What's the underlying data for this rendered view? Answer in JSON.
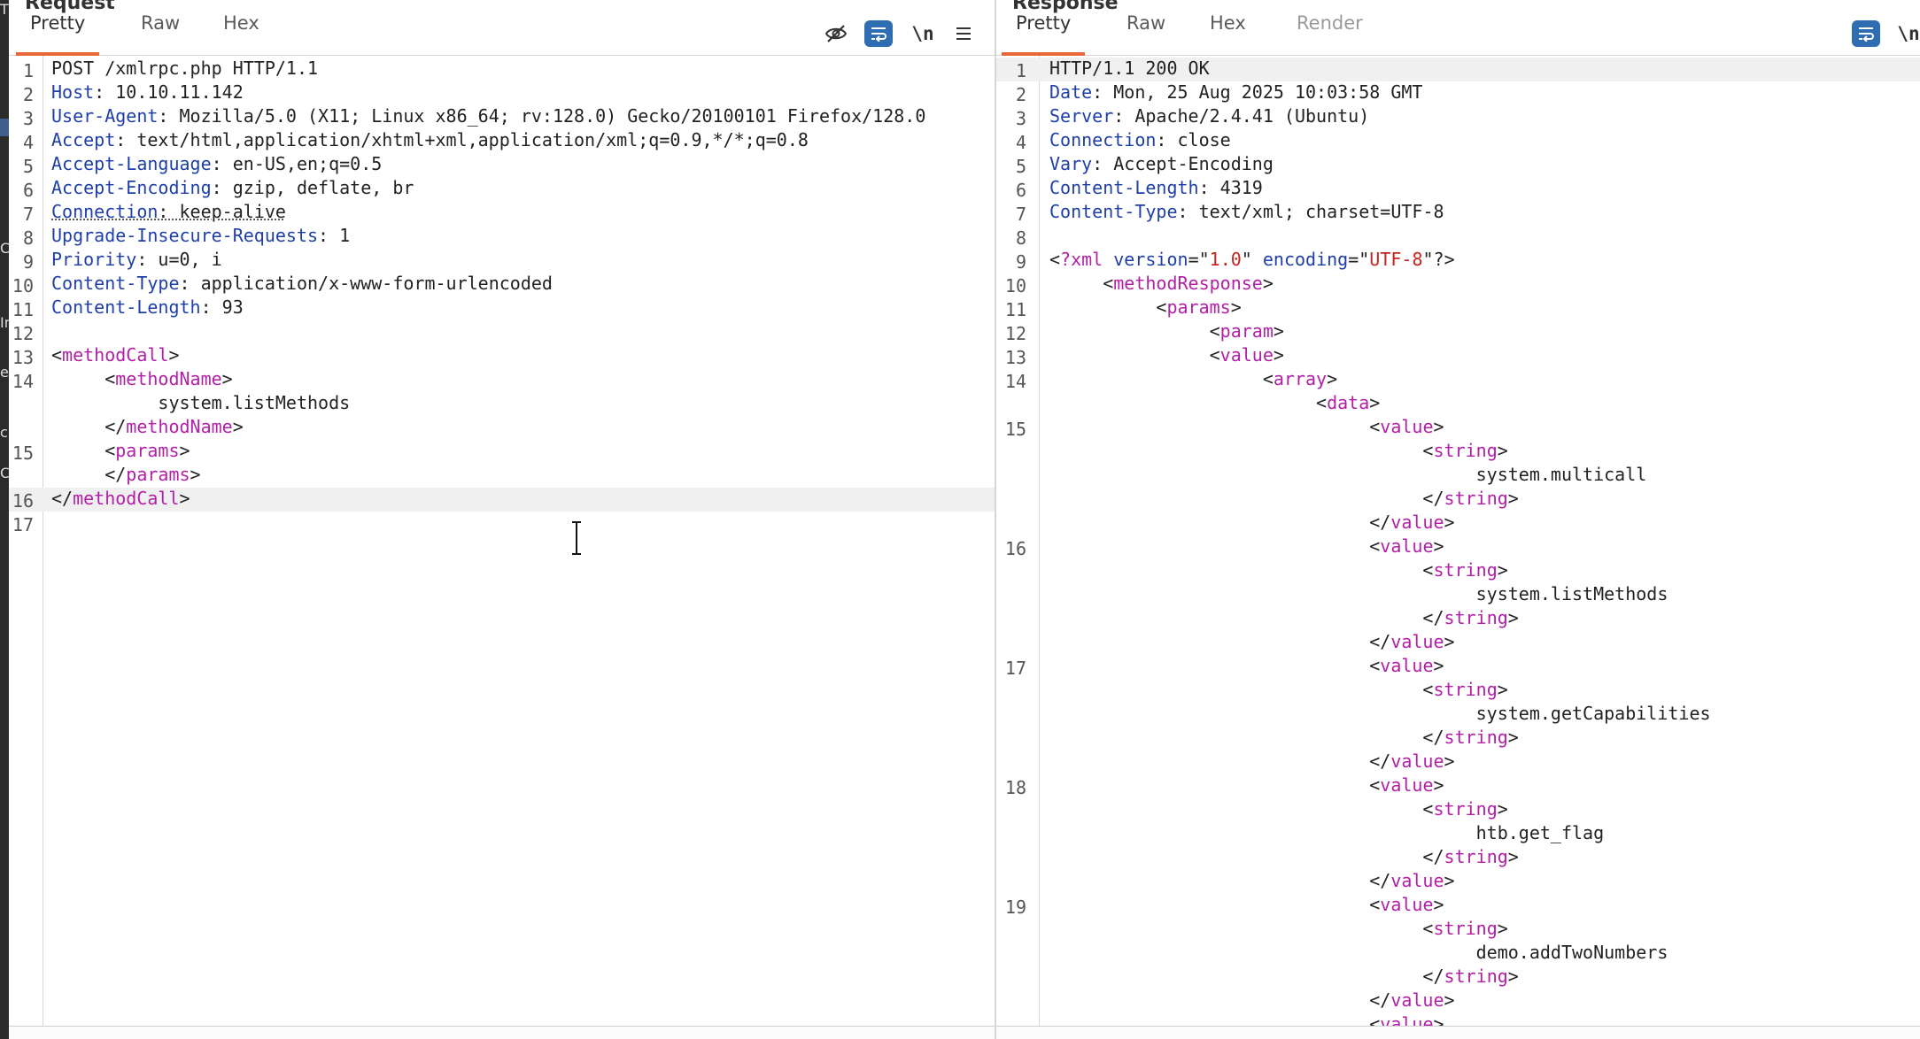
{
  "left_strip": {
    "glyphs": [
      "T",
      "C",
      "Ir",
      "e",
      "c",
      "C"
    ]
  },
  "request": {
    "title": "Request",
    "tabs": [
      "Pretty",
      "Raw",
      "Hex"
    ],
    "active_tab": "Pretty",
    "toolbar": {
      "newline_label": "\\n"
    },
    "lines": [
      {
        "ln": "1",
        "parts": [
          {
            "t": "POST /xmlrpc.php HTTP/1.1"
          }
        ]
      },
      {
        "ln": "2",
        "parts": [
          {
            "t": "Host",
            "c": "hn"
          },
          {
            "t": ": 10.10.11.142"
          }
        ]
      },
      {
        "ln": "3",
        "parts": [
          {
            "t": "User-Agent",
            "c": "hn"
          },
          {
            "t": ": Mozilla/5.0 (X11; Linux x86_64; rv:128.0) Gecko/20100101 Firefox/128.0"
          }
        ]
      },
      {
        "ln": "4",
        "parts": [
          {
            "t": "Accept",
            "c": "hn"
          },
          {
            "t": ": text/html,application/xhtml+xml,application/xml;q=0.9,*/*;q=0.8"
          }
        ]
      },
      {
        "ln": "5",
        "parts": [
          {
            "t": "Accept-Language",
            "c": "hn"
          },
          {
            "t": ": en-US,en;q=0.5"
          }
        ]
      },
      {
        "ln": "6",
        "parts": [
          {
            "t": "Accept-Encoding",
            "c": "hn"
          },
          {
            "t": ": gzip, deflate, br"
          }
        ]
      },
      {
        "ln": "7",
        "parts": [
          {
            "t": "Connection",
            "c": "hn dotted"
          },
          {
            "t": ": keep-alive",
            "c": "dotted"
          }
        ]
      },
      {
        "ln": "8",
        "parts": [
          {
            "t": "Upgrade-Insecure-Requests",
            "c": "hn"
          },
          {
            "t": ": 1"
          }
        ]
      },
      {
        "ln": "9",
        "parts": [
          {
            "t": "Priority",
            "c": "hn"
          },
          {
            "t": ": u=0, i"
          }
        ]
      },
      {
        "ln": "10",
        "parts": [
          {
            "t": "Content-Type",
            "c": "hn"
          },
          {
            "t": ": application/x-www-form-urlencoded"
          }
        ]
      },
      {
        "ln": "11",
        "parts": [
          {
            "t": "Content-Length",
            "c": "hn"
          },
          {
            "t": ": 93"
          }
        ]
      },
      {
        "ln": "12",
        "parts": []
      },
      {
        "ln": "13",
        "parts": [
          {
            "t": "<"
          },
          {
            "t": "methodCall",
            "c": "tg"
          },
          {
            "t": ">"
          }
        ]
      },
      {
        "ln": "14",
        "parts": [
          {
            "t": "     <"
          },
          {
            "t": "methodName",
            "c": "tg"
          },
          {
            "t": ">"
          }
        ]
      },
      {
        "ln": "",
        "parts": [
          {
            "t": "          system.listMethods"
          }
        ]
      },
      {
        "ln": "",
        "parts": [
          {
            "t": "     </"
          },
          {
            "t": "methodName",
            "c": "tg"
          },
          {
            "t": ">"
          }
        ]
      },
      {
        "ln": "15",
        "parts": [
          {
            "t": "     <"
          },
          {
            "t": "params",
            "c": "tg"
          },
          {
            "t": ">"
          }
        ]
      },
      {
        "ln": "",
        "parts": [
          {
            "t": "     </"
          },
          {
            "t": "params",
            "c": "tg"
          },
          {
            "t": ">"
          }
        ]
      },
      {
        "ln": "16",
        "current": true,
        "parts": [
          {
            "t": "</"
          },
          {
            "t": "methodCall",
            "c": "tg"
          },
          {
            "t": ">"
          }
        ]
      },
      {
        "ln": "17",
        "parts": []
      }
    ]
  },
  "response": {
    "title": "Response",
    "tabs": [
      "Pretty",
      "Raw",
      "Hex",
      "Render"
    ],
    "active_tab": "Pretty",
    "disabled_tabs": [
      "Render"
    ],
    "toolbar": {
      "newline_label": "\\n"
    },
    "lines": [
      {
        "ln": "1",
        "current": true,
        "parts": [
          {
            "t": "HTTP/1.1 200 OK"
          }
        ]
      },
      {
        "ln": "2",
        "parts": [
          {
            "t": "Date",
            "c": "hn"
          },
          {
            "t": ": Mon, 25 Aug 2025 10:03:58 GMT"
          }
        ]
      },
      {
        "ln": "3",
        "parts": [
          {
            "t": "Server",
            "c": "hn"
          },
          {
            "t": ": Apache/2.4.41 (Ubuntu)"
          }
        ]
      },
      {
        "ln": "4",
        "parts": [
          {
            "t": "Connection",
            "c": "hn"
          },
          {
            "t": ": close"
          }
        ]
      },
      {
        "ln": "5",
        "parts": [
          {
            "t": "Vary",
            "c": "hn"
          },
          {
            "t": ": Accept-Encoding"
          }
        ]
      },
      {
        "ln": "6",
        "parts": [
          {
            "t": "Content-Length",
            "c": "hn"
          },
          {
            "t": ": 4319"
          }
        ]
      },
      {
        "ln": "7",
        "parts": [
          {
            "t": "Content-Type",
            "c": "hn"
          },
          {
            "t": ": text/xml; charset=UTF-8"
          }
        ]
      },
      {
        "ln": "8",
        "parts": []
      },
      {
        "ln": "9",
        "parts": [
          {
            "t": "<"
          },
          {
            "t": "?xml",
            "c": "tg"
          },
          {
            "t": " "
          },
          {
            "t": "version",
            "c": "at"
          },
          {
            "t": "=\""
          },
          {
            "t": "1.0",
            "c": "vl"
          },
          {
            "t": "\" "
          },
          {
            "t": "encoding",
            "c": "at"
          },
          {
            "t": "=\""
          },
          {
            "t": "UTF-8",
            "c": "vl"
          },
          {
            "t": "\"?>"
          }
        ]
      },
      {
        "ln": "10",
        "parts": [
          {
            "t": "     <"
          },
          {
            "t": "methodResponse",
            "c": "tg"
          },
          {
            "t": ">"
          }
        ]
      },
      {
        "ln": "11",
        "parts": [
          {
            "t": "          <"
          },
          {
            "t": "params",
            "c": "tg"
          },
          {
            "t": ">"
          }
        ]
      },
      {
        "ln": "12",
        "parts": [
          {
            "t": "               <"
          },
          {
            "t": "param",
            "c": "tg"
          },
          {
            "t": ">"
          }
        ]
      },
      {
        "ln": "13",
        "parts": [
          {
            "t": "               <"
          },
          {
            "t": "value",
            "c": "tg"
          },
          {
            "t": ">"
          }
        ]
      },
      {
        "ln": "14",
        "parts": [
          {
            "t": "                    <"
          },
          {
            "t": "array",
            "c": "tg"
          },
          {
            "t": ">"
          }
        ]
      },
      {
        "ln": "",
        "parts": [
          {
            "t": "                         <"
          },
          {
            "t": "data",
            "c": "tg"
          },
          {
            "t": ">"
          }
        ]
      },
      {
        "ln": "15",
        "parts": [
          {
            "t": "                              <"
          },
          {
            "t": "value",
            "c": "tg"
          },
          {
            "t": ">"
          }
        ]
      },
      {
        "ln": "",
        "parts": [
          {
            "t": "                                   <"
          },
          {
            "t": "string",
            "c": "tg"
          },
          {
            "t": ">"
          }
        ]
      },
      {
        "ln": "",
        "parts": [
          {
            "t": "                                        system.multicall"
          }
        ]
      },
      {
        "ln": "",
        "parts": [
          {
            "t": "                                   </"
          },
          {
            "t": "string",
            "c": "tg"
          },
          {
            "t": ">"
          }
        ]
      },
      {
        "ln": "",
        "parts": [
          {
            "t": "                              </"
          },
          {
            "t": "value",
            "c": "tg"
          },
          {
            "t": ">"
          }
        ]
      },
      {
        "ln": "16",
        "parts": [
          {
            "t": "                              <"
          },
          {
            "t": "value",
            "c": "tg"
          },
          {
            "t": ">"
          }
        ]
      },
      {
        "ln": "",
        "parts": [
          {
            "t": "                                   <"
          },
          {
            "t": "string",
            "c": "tg"
          },
          {
            "t": ">"
          }
        ]
      },
      {
        "ln": "",
        "parts": [
          {
            "t": "                                        system.listMethods"
          }
        ]
      },
      {
        "ln": "",
        "parts": [
          {
            "t": "                                   </"
          },
          {
            "t": "string",
            "c": "tg"
          },
          {
            "t": ">"
          }
        ]
      },
      {
        "ln": "",
        "parts": [
          {
            "t": "                              </"
          },
          {
            "t": "value",
            "c": "tg"
          },
          {
            "t": ">"
          }
        ]
      },
      {
        "ln": "17",
        "parts": [
          {
            "t": "                              <"
          },
          {
            "t": "value",
            "c": "tg"
          },
          {
            "t": ">"
          }
        ]
      },
      {
        "ln": "",
        "parts": [
          {
            "t": "                                   <"
          },
          {
            "t": "string",
            "c": "tg"
          },
          {
            "t": ">"
          }
        ]
      },
      {
        "ln": "",
        "parts": [
          {
            "t": "                                        system.getCapabilities"
          }
        ]
      },
      {
        "ln": "",
        "parts": [
          {
            "t": "                                   </"
          },
          {
            "t": "string",
            "c": "tg"
          },
          {
            "t": ">"
          }
        ]
      },
      {
        "ln": "",
        "parts": [
          {
            "t": "                              </"
          },
          {
            "t": "value",
            "c": "tg"
          },
          {
            "t": ">"
          }
        ]
      },
      {
        "ln": "18",
        "parts": [
          {
            "t": "                              <"
          },
          {
            "t": "value",
            "c": "tg"
          },
          {
            "t": ">"
          }
        ]
      },
      {
        "ln": "",
        "parts": [
          {
            "t": "                                   <"
          },
          {
            "t": "string",
            "c": "tg"
          },
          {
            "t": ">"
          }
        ]
      },
      {
        "ln": "",
        "parts": [
          {
            "t": "                                        htb.get_flag"
          }
        ]
      },
      {
        "ln": "",
        "parts": [
          {
            "t": "                                   </"
          },
          {
            "t": "string",
            "c": "tg"
          },
          {
            "t": ">"
          }
        ]
      },
      {
        "ln": "",
        "parts": [
          {
            "t": "                              </"
          },
          {
            "t": "value",
            "c": "tg"
          },
          {
            "t": ">"
          }
        ]
      },
      {
        "ln": "19",
        "parts": [
          {
            "t": "                              <"
          },
          {
            "t": "value",
            "c": "tg"
          },
          {
            "t": ">"
          }
        ]
      },
      {
        "ln": "",
        "parts": [
          {
            "t": "                                   <"
          },
          {
            "t": "string",
            "c": "tg"
          },
          {
            "t": ">"
          }
        ]
      },
      {
        "ln": "",
        "parts": [
          {
            "t": "                                        demo.addTwoNumbers"
          }
        ]
      },
      {
        "ln": "",
        "parts": [
          {
            "t": "                                   </"
          },
          {
            "t": "string",
            "c": "tg"
          },
          {
            "t": ">"
          }
        ]
      },
      {
        "ln": "",
        "parts": [
          {
            "t": "                              </"
          },
          {
            "t": "value",
            "c": "tg"
          },
          {
            "t": ">"
          }
        ]
      },
      {
        "ln": "",
        "parts": [
          {
            "t": "                              <"
          },
          {
            "t": "value",
            "c": "tg"
          },
          {
            "t": ">"
          }
        ]
      }
    ]
  },
  "colors": {
    "tab_accent": "#e8673a",
    "toolbar_active": "#2f6db3",
    "header_name": "#1f3fa8",
    "xml_tag": "#b220a6",
    "xml_value": "#c8241e"
  }
}
